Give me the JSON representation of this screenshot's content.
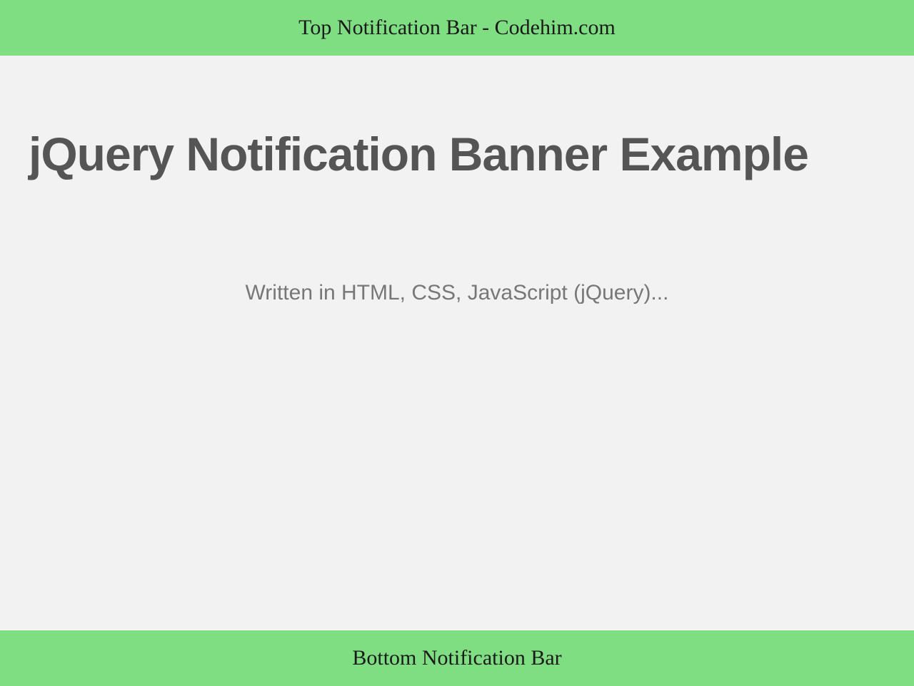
{
  "topBar": {
    "text": "Top Notification Bar - Codehim.com"
  },
  "main": {
    "heading": "jQuery Notification Banner Example",
    "subtitle": "Written in HTML, CSS, JavaScript (jQuery)..."
  },
  "bottomBar": {
    "text": "Bottom Notification Bar"
  },
  "colors": {
    "barBackground": "#7ede81",
    "pageBackground": "#f2f2f2",
    "headingText": "#555555",
    "subtitleText": "#777777"
  }
}
